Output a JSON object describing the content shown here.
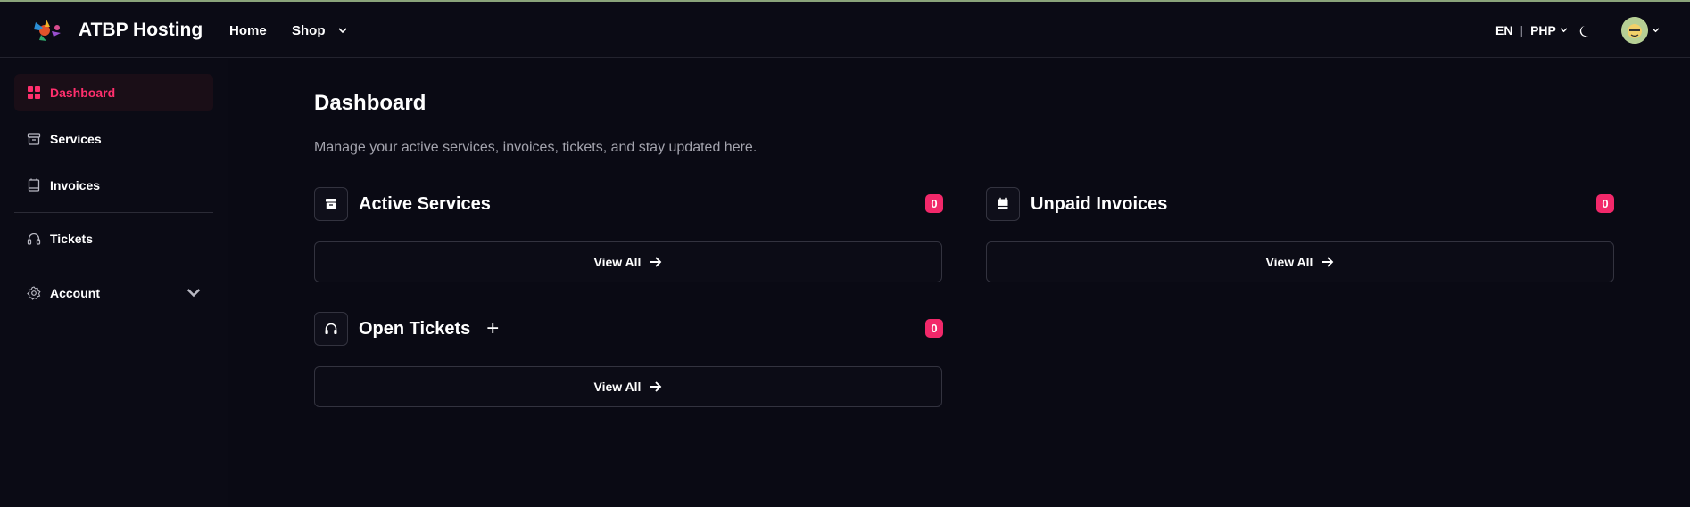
{
  "header": {
    "brand": "ATBP Hosting",
    "nav": {
      "home": "Home",
      "shop": "Shop"
    },
    "language": "EN",
    "currency": "PHP"
  },
  "sidebar": {
    "items": [
      {
        "label": "Dashboard",
        "icon": "grid-icon",
        "active": true
      },
      {
        "label": "Services",
        "icon": "archive-icon"
      },
      {
        "label": "Invoices",
        "icon": "receipt-icon"
      },
      {
        "label": "Tickets",
        "icon": "headset-icon"
      },
      {
        "label": "Account",
        "icon": "gear-icon"
      }
    ]
  },
  "main": {
    "title": "Dashboard",
    "subtitle": "Manage your active services, invoices, tickets, and stay updated here.",
    "cards": {
      "active_services": {
        "title": "Active Services",
        "count": "0",
        "button": "View All"
      },
      "unpaid_invoices": {
        "title": "Unpaid Invoices",
        "count": "0",
        "button": "View All"
      },
      "open_tickets": {
        "title": "Open Tickets",
        "count": "0",
        "button": "View All",
        "add": "+"
      }
    }
  },
  "colors": {
    "accent": "#f2286a",
    "background": "#0a0a14",
    "border": "#33333f"
  }
}
